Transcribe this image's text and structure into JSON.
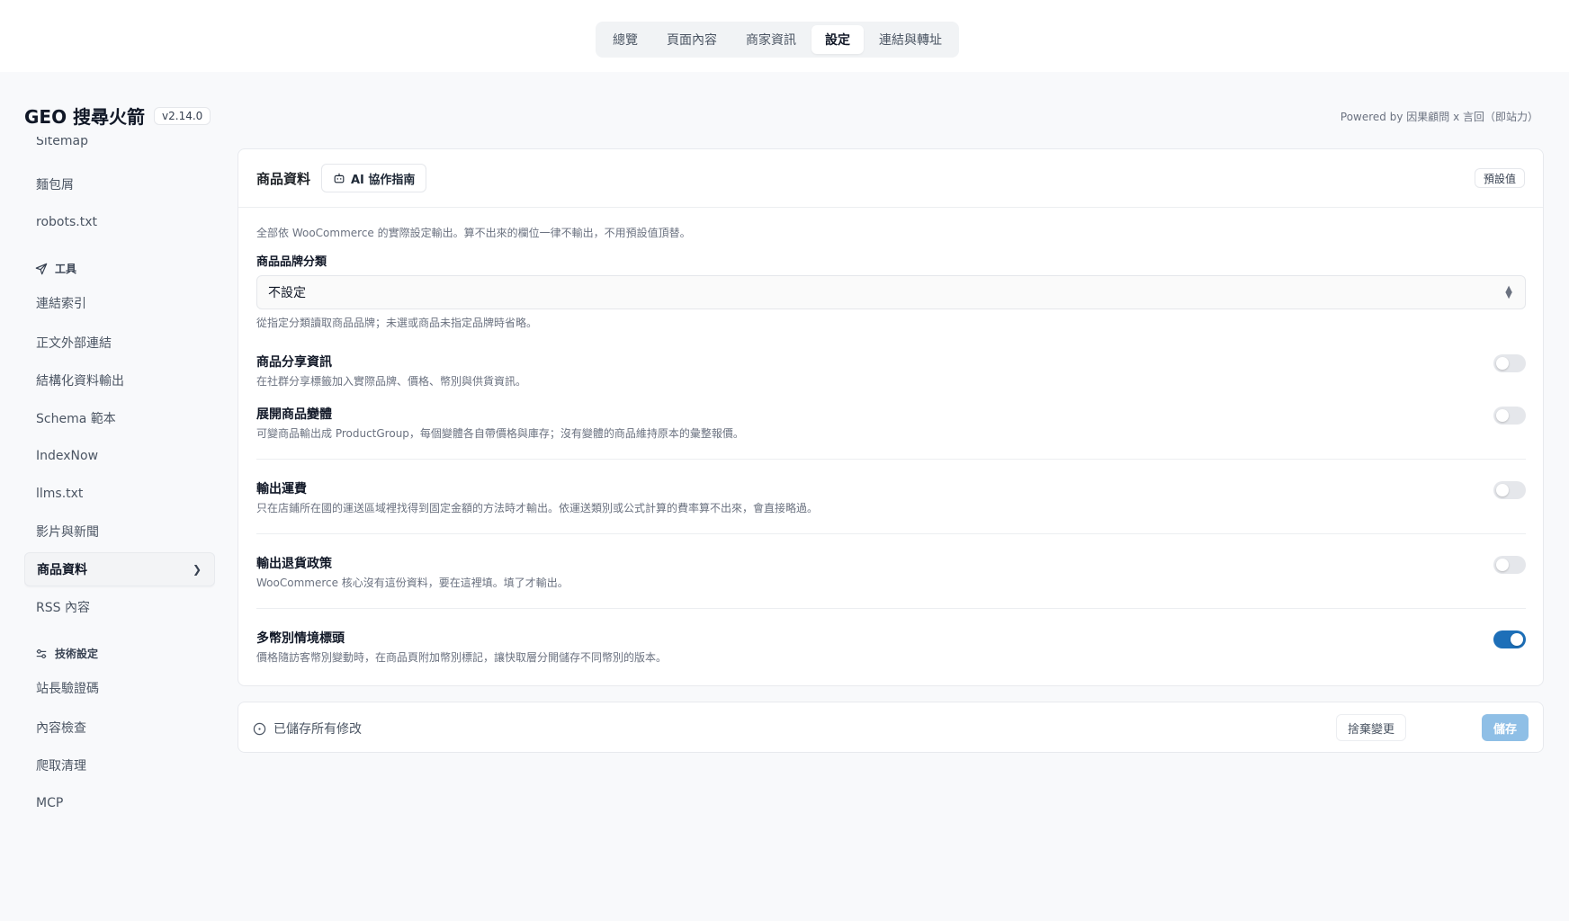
{
  "top_tabs": [
    {
      "label": "總覽",
      "active": false
    },
    {
      "label": "頁面內容",
      "active": false
    },
    {
      "label": "商家資訊",
      "active": false
    },
    {
      "label": "設定",
      "active": true
    },
    {
      "label": "連結與轉址",
      "active": false
    }
  ],
  "header": {
    "app_name": "GEO 搜尋火箭",
    "version": "v2.14.0",
    "powered_by": "Powered by 因果顧問 x 言回（即站力）"
  },
  "sidebar": {
    "partial_top_item": "Sitemap",
    "items_group_a": [
      "麵包屑",
      "robots.txt"
    ],
    "section_tools": {
      "label": "工具",
      "icon": "send-icon"
    },
    "tools_items": [
      "連結索引",
      "正文外部連結",
      "結構化資料輸出",
      "Schema 範本",
      "IndexNow",
      "llms.txt",
      "影片與新聞"
    ],
    "active_item": "商品資料",
    "after_active": "RSS 內容",
    "section_tech": {
      "label": "技術設定",
      "icon": "sliders-icon"
    },
    "tech_items": [
      "站長驗證碼",
      "內容檢查",
      "爬取清理",
      "MCP"
    ]
  },
  "panel": {
    "title": "商品資料",
    "ai_guide_label": "AI 協作指南",
    "default_label": "預設值",
    "intro": "全部依 WooCommerce 的實際設定輸出。算不出來的欄位一律不輸出，不用預設值頂替。",
    "brand_label": "商品品牌分類",
    "brand_value": "不設定",
    "brand_help": "從指定分類讀取商品品牌；未選或商品未指定品牌時省略。",
    "rows": [
      {
        "title": "商品分享資訊",
        "desc": "在社群分享標籤加入實際品牌、價格、幣別與供貨資訊。",
        "enabled": false
      },
      {
        "title": "展開商品變體",
        "desc": "可變商品輸出成 ProductGroup，每個變體各自帶價格與庫存；沒有變體的商品維持原本的彙整報價。",
        "enabled": false
      },
      {
        "title": "輸出運費",
        "desc": "只在店鋪所在國的運送區域裡找得到固定金額的方法時才輸出。依運送類別或公式計算的費率算不出來，會直接略過。",
        "enabled": false
      },
      {
        "title": "輸出退貨政策",
        "desc": "WooCommerce 核心沒有這份資料，要在這裡填。填了才輸出。",
        "enabled": false
      },
      {
        "title": "多幣別情境標頭",
        "desc": "價格隨訪客幣別變動時，在商品頁附加幣別標記，讓快取層分開儲存不同幣別的版本。",
        "enabled": true
      }
    ]
  },
  "savebar": {
    "status": "已儲存所有修改",
    "discard_label": "捨棄變更",
    "save_label": "儲存"
  },
  "colors": {
    "accent": "#1d6fb8",
    "save_disabled": "#8fbfe6",
    "background": "#f8f9fb"
  }
}
